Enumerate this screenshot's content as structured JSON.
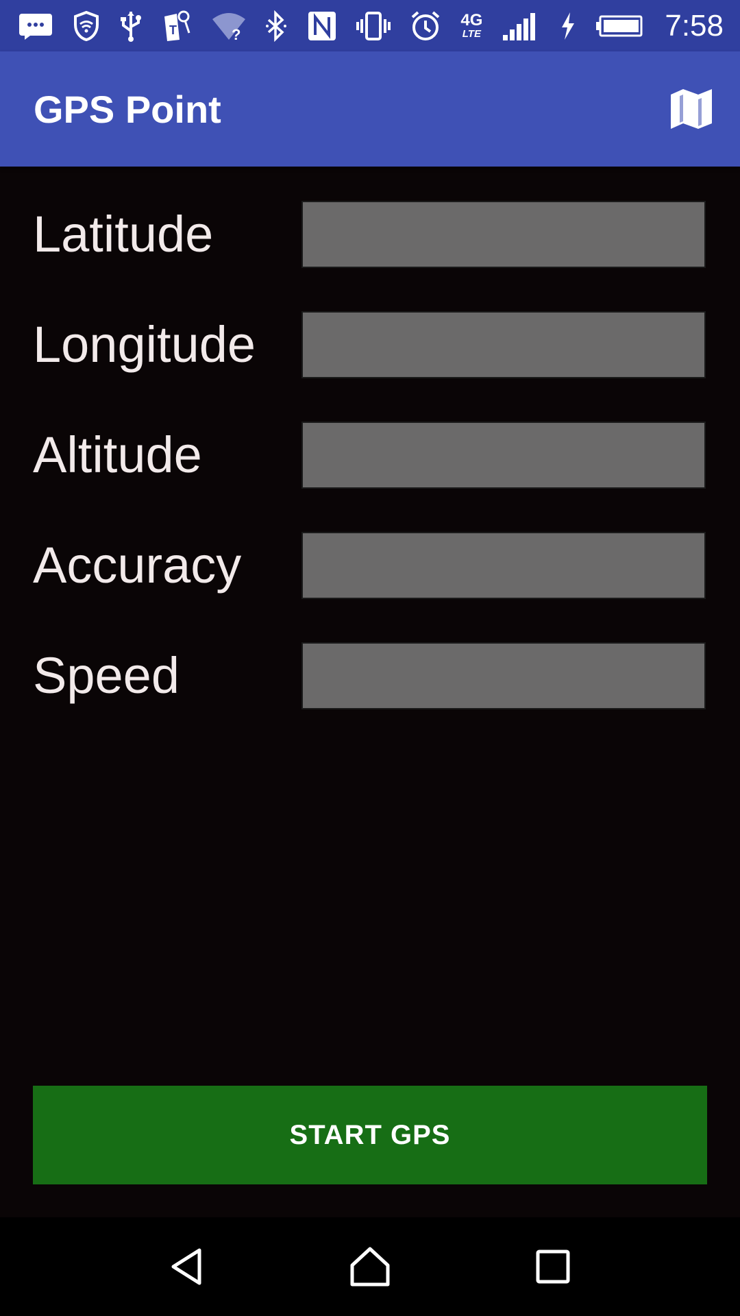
{
  "status_bar": {
    "time": "7:58",
    "network_type": "4G",
    "network_subtype": "LTE",
    "icons_left": [
      "messages-icon",
      "vpn-shield-icon",
      "usb-icon",
      "carrier-t-icon",
      "wifi-unknown-icon"
    ],
    "icons_right": [
      "bluetooth-icon",
      "nfc-icon",
      "vibrate-icon",
      "alarm-icon",
      "signal-icon",
      "charging-icon",
      "battery-icon"
    ]
  },
  "app_bar": {
    "title": "GPS Point",
    "map_icon": "map-icon"
  },
  "fields": [
    {
      "label": "Latitude",
      "value": ""
    },
    {
      "label": "Longitude",
      "value": ""
    },
    {
      "label": "Altitude",
      "value": ""
    },
    {
      "label": "Accuracy",
      "value": ""
    },
    {
      "label": "Speed",
      "value": ""
    }
  ],
  "start_button": {
    "label": "START GPS"
  },
  "colors": {
    "status_bar": "#303f9f",
    "app_bar": "#3f51b5",
    "background": "#0a0506",
    "field_bg": "#6b6a6a",
    "button": "#176e15"
  }
}
